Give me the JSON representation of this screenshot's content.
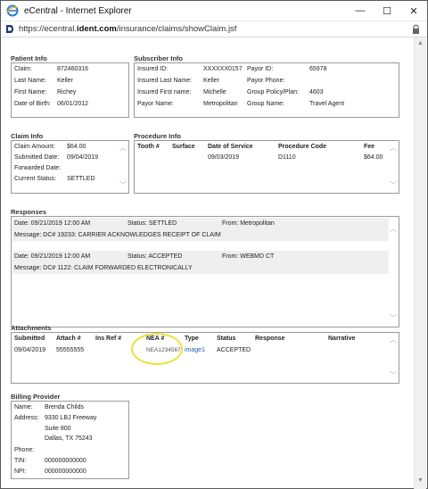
{
  "window": {
    "title": "eCentral - Internet Explorer",
    "url_prefix": "https://ecentral.",
    "url_domain": "ident.com",
    "url_path": "/insurance/claims/showClaim.jsf",
    "minimize_glyph": "—",
    "maximize_glyph": "☐",
    "close_glyph": "✕"
  },
  "patient_info": {
    "heading": "Patient Info",
    "fields": [
      {
        "label": "Claim:",
        "value": "872460316"
      },
      {
        "label": "Last Name:",
        "value": "Keller"
      },
      {
        "label": "First Name:",
        "value": "Richey"
      },
      {
        "label": "Date of Birth:",
        "value": "06/01/2012"
      }
    ]
  },
  "subscriber_info": {
    "heading": "Subscriber Info",
    "left": [
      {
        "label": "Insured ID:",
        "value": "XXXXXX0157"
      },
      {
        "label": "Insured Last Name:",
        "value": "Keller"
      },
      {
        "label": "Insured First name:",
        "value": "Michelle"
      },
      {
        "label": "Payor Name:",
        "value": "Metropolitan"
      }
    ],
    "right": [
      {
        "label": "Payor ID:",
        "value": "65978"
      },
      {
        "label": "Payor Phone:",
        "value": ""
      },
      {
        "label": "Group Policy/Plan:",
        "value": "4603"
      },
      {
        "label": "Group Name:",
        "value": "Travel Agent"
      }
    ]
  },
  "claim_info": {
    "heading": "Claim Info",
    "fields": [
      {
        "label": "Claim Amount:",
        "value": "$64.00"
      },
      {
        "label": "Submitted Date:",
        "value": "09/04/2019"
      },
      {
        "label": "Forwarded Date:",
        "value": ""
      },
      {
        "label": "Current Status:",
        "value": "SETTLED"
      }
    ]
  },
  "procedure_info": {
    "heading": "Procedure Info",
    "columns": [
      "Tooth #",
      "Surface",
      "Date of Service",
      "Procedure Code",
      "Fee"
    ],
    "rows": [
      {
        "tooth": "",
        "surface": "",
        "date": "09/03/2019",
        "code": "D1110",
        "fee": "$64.00"
      }
    ]
  },
  "responses": {
    "heading": "Responses",
    "items": [
      {
        "date": "Date:  09/21/2019 12:00 AM",
        "status": "Status:  SETTLED",
        "from": "From:  Metropolitan",
        "message": "Message:  DC# 19233: CARRIER ACKNOWLEDGES RECEIPT OF CLAIM"
      },
      {
        "date": "Date:  09/21/2019 12:00 AM",
        "status": "Status:  ACCEPTED",
        "from": "From:  WEBMD CT",
        "message": "Message:  DC# 1122: CLAIM FORWARDED ELECTRONICALLY"
      }
    ]
  },
  "attachments": {
    "heading": "Attachments",
    "columns": [
      "Submitted",
      "Attach #",
      "Ins Ref #",
      "NEA #",
      "Type",
      "Status",
      "Response",
      "Narrative"
    ],
    "rows": [
      {
        "submitted": "09/04/2019",
        "attach": "55555555",
        "insref": "",
        "nea": "NEA1234567",
        "type": "image1",
        "status": "ACCEPTED",
        "response": "",
        "narrative": ""
      }
    ]
  },
  "billing_provider": {
    "heading": "Billing Provider",
    "fields": [
      {
        "label": "Name:",
        "value": "Brenda Childs"
      },
      {
        "label": "Address:",
        "value": "9330 LBJ Freeway"
      },
      {
        "label": "",
        "value": "Suite 800"
      },
      {
        "label": "",
        "value": "Dallas, TX 75243"
      },
      {
        "label": "Phone:",
        "value": ""
      },
      {
        "label": "TIN:",
        "value": "000000000000"
      },
      {
        "label": "NPI:",
        "value": "000000000000"
      }
    ]
  },
  "colors": {
    "highlight_circle": "#e8e337",
    "link": "#1a5fb4",
    "panel_border": "#9a9a9a",
    "response_row_bg": "#efefef"
  },
  "icons": [
    "ie-icon",
    "site-icon",
    "lock-icon",
    "scroll-up-icon",
    "scroll-down-icon"
  ]
}
